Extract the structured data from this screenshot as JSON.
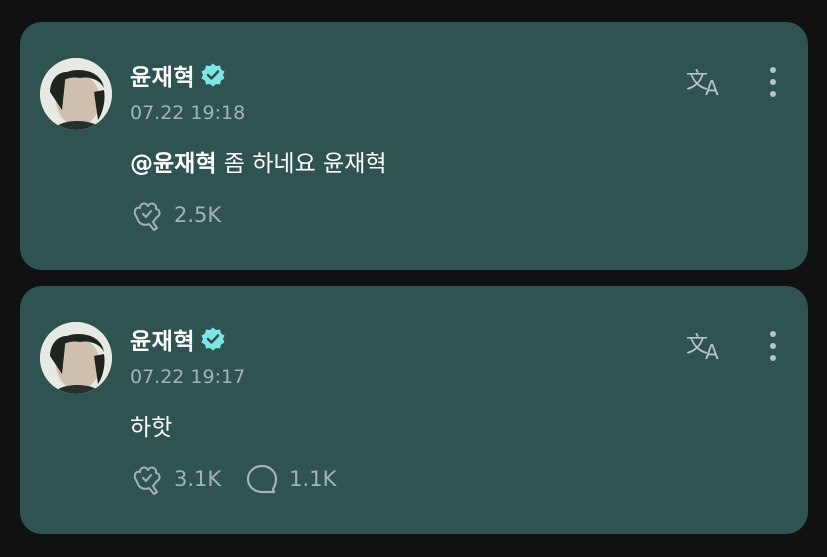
{
  "posts": [
    {
      "author": "윤재혁",
      "time": "07.22 19:18",
      "mention": "@윤재혁",
      "body": " 좀 하네요 윤재혁",
      "likes": "2.5K",
      "comments": ""
    },
    {
      "author": "윤재혁",
      "time": "07.22 19:17",
      "mention": "",
      "body": "하핫",
      "likes": "3.1K",
      "comments": "1.1K"
    }
  ],
  "colors": {
    "card": "#2f5350",
    "background": "#111111",
    "verified": "#7ee6e4",
    "muted": "#a4b3b1"
  },
  "icons": {
    "verified": "verified-badge-icon",
    "translate": "translate-icon",
    "more": "more-vertical-icon",
    "like": "like-cheer-icon",
    "comment": "comment-icon"
  }
}
